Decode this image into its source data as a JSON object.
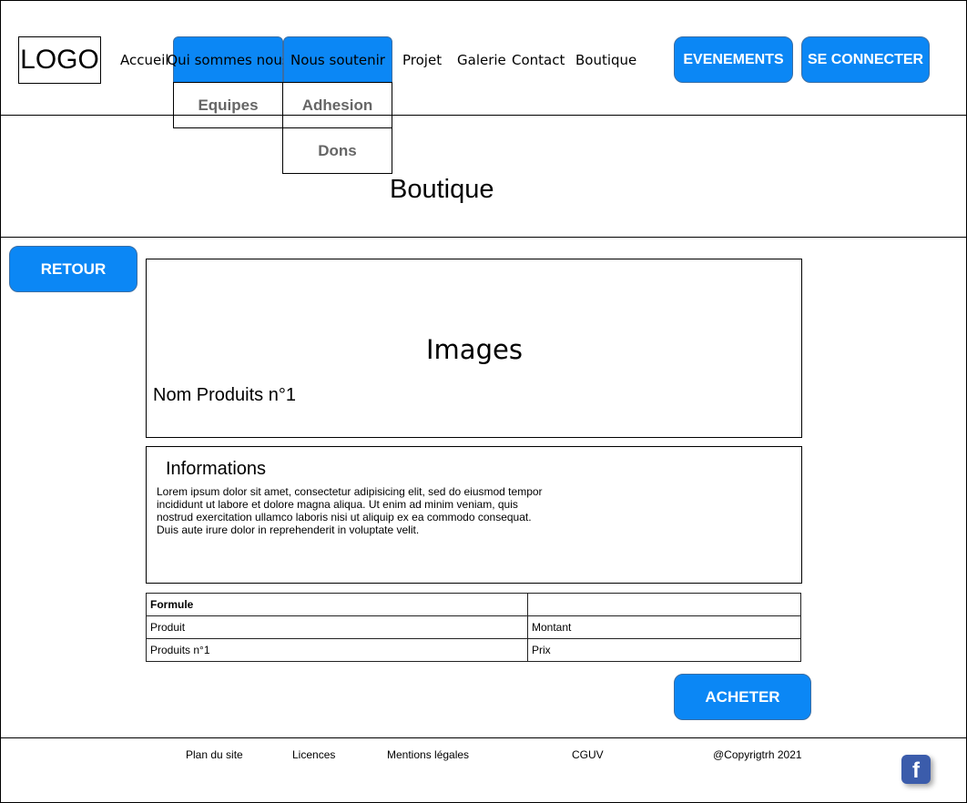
{
  "header": {
    "logo": "LOGO",
    "nav": {
      "accueil": "Accueil",
      "qui": "Qui sommes nous",
      "soutenir": "Nous soutenir",
      "projet": "Projet",
      "galerie": "Galerie",
      "contact": "Contact",
      "boutique": "Boutique"
    },
    "dropdowns": {
      "equipes": "Equipes",
      "adhesion": "Adhesion",
      "dons": "Dons"
    },
    "buttons": {
      "evenements": "EVENEMENTS",
      "connect": "SE CONNECTER"
    }
  },
  "page_title": "Boutique",
  "retour": "RETOUR",
  "product": {
    "images_label": "Images",
    "name": "Nom Produits n°1",
    "info_title": "Informations",
    "info_text": "Lorem ipsum dolor sit amet, consectetur adipisicing elit, sed do eiusmod tempor incididunt ut labore et dolore magna aliqua. Ut enim ad minim veniam, quis nostrud exercitation ullamco laboris nisi ut aliquip ex ea commodo consequat. Duis aute irure dolor in reprehenderit in voluptate velit."
  },
  "table": {
    "header": [
      "Formule",
      ""
    ],
    "rows": [
      [
        "Produit",
        "Montant"
      ],
      [
        "Produits n°1",
        "Prix"
      ]
    ]
  },
  "acheter": "ACHETER",
  "footer": {
    "plan": "Plan du site",
    "licences": "Licences",
    "mentions": "Mentions légales",
    "cguv": "CGUV",
    "copyright": "@Copyrigtrh 2021",
    "facebook_icon": "f"
  },
  "colors": {
    "accent": "#0b87f5",
    "facebook": "#3b5cab"
  }
}
